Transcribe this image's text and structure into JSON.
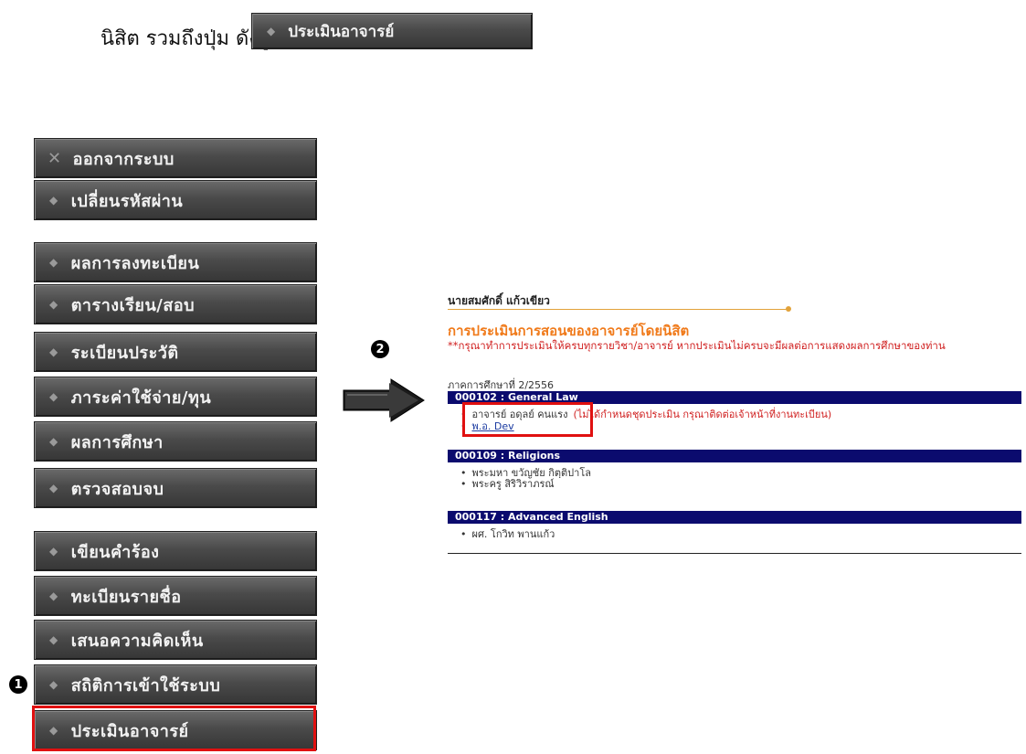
{
  "intro": {
    "text": "นิสิต รวมถึงปุ่ม ดังรูป",
    "button_label": "ประเมินอาจารย์"
  },
  "menu": {
    "items": [
      {
        "label": "ออกจากระบบ",
        "icon": "close-icon"
      },
      {
        "label": "เปลี่ยนรหัสผ่าน"
      },
      {
        "label": "ผลการลงทะเบียน"
      },
      {
        "label": "ตารางเรียน/สอบ"
      },
      {
        "label": "ระเบียนประวัติ"
      },
      {
        "label": "ภาระค่าใช้จ่าย/ทุน"
      },
      {
        "label": "ผลการศึกษา"
      },
      {
        "label": "ตรวจสอบจบ"
      },
      {
        "label": "เขียนคำร้อง"
      },
      {
        "label": "ทะเบียนรายชื่อ"
      },
      {
        "label": "เสนอความคิดเห็น"
      },
      {
        "label": "สถิติการเข้าใช้ระบบ"
      },
      {
        "label": "ประเมินอาจารย์"
      }
    ]
  },
  "markers": {
    "one": "1",
    "two": "2"
  },
  "panel": {
    "student_name": "นายสมศักดิ์ แก้วเขียว",
    "title": "การประเมินการสอนของอาจารย์โดยนิสิต",
    "note": "**กรุณาทำการประเมินให้ครบทุกรายวิชา/อาจารย์ หากประเมินไม่ครบจะมีผลต่อการแสดงผลการศึกษาของท่าน",
    "term": "ภาคการศึกษาที่ 2/2556",
    "courses": [
      {
        "header": "000102 : General Law",
        "teachers": [
          "อาจารย์ อดุลย์ คนแรง",
          "พ.อ. Dev"
        ],
        "warning": "(ไม่ได้กำหนดชุดประเมิน กรุณาติดต่อเจ้าหน้าที่งานทะเบียน)"
      },
      {
        "header": "000109 : Religions",
        "teachers": [
          "พระมหา ขวัญชัย กิตฺติปาโล",
          "พระครู สิริวิราภรณ์"
        ]
      },
      {
        "header": "000117 : Advanced English",
        "teachers": [
          "ผศ. โกวิท พานแก้ว"
        ]
      }
    ]
  },
  "colors": {
    "accent_orange": "#f07a1a",
    "course_header_bg": "#0b0b6e",
    "highlight_red": "#e01010",
    "button_gray": "#4a4a4a"
  }
}
